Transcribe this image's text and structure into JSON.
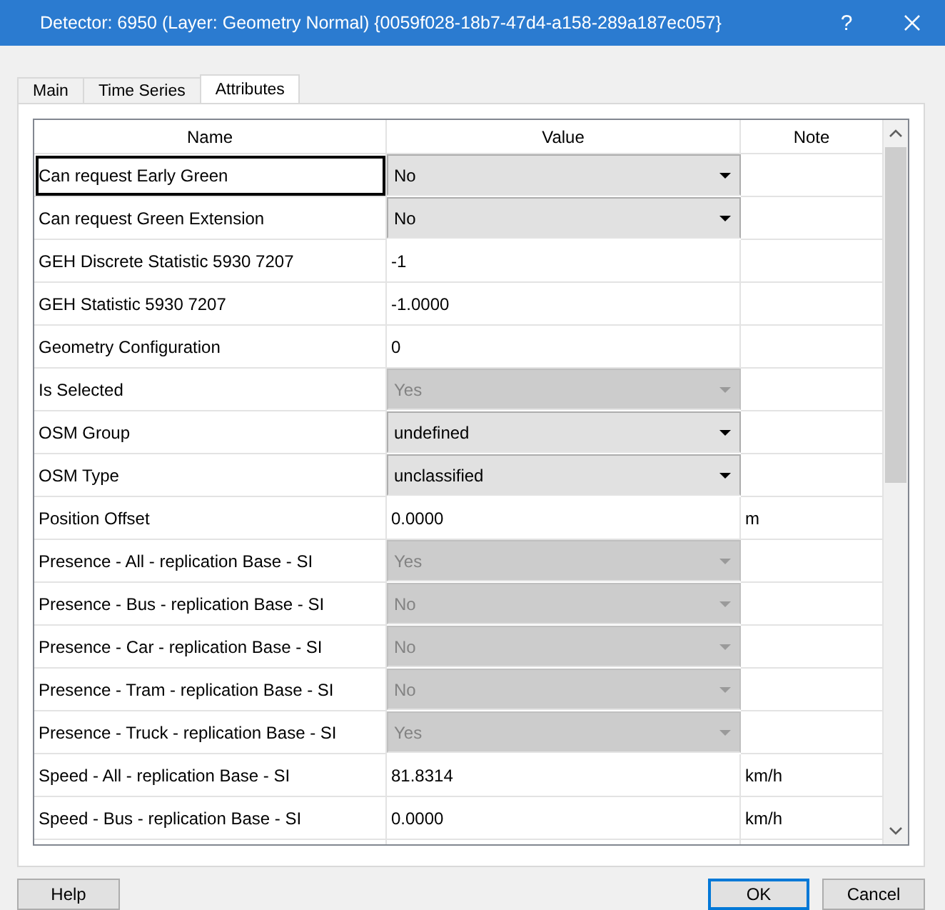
{
  "window": {
    "title": "Detector: 6950 (Layer: Geometry Normal) {0059f028-18b7-47d4-a158-289a187ec057}",
    "help_glyph": "?"
  },
  "tabs": [
    {
      "label": "Main",
      "selected": false
    },
    {
      "label": "Time Series",
      "selected": false
    },
    {
      "label": "Attributes",
      "selected": true
    }
  ],
  "table": {
    "columns": [
      "Name",
      "Value",
      "Note"
    ],
    "rows": [
      {
        "name": "Can request Early Green",
        "kind": "dropdown",
        "value": "No",
        "disabled": false,
        "focused": true
      },
      {
        "name": "Can request Green Extension",
        "kind": "dropdown",
        "value": "No",
        "disabled": false,
        "focused": false
      },
      {
        "name": "GEH Discrete Statistic 5930 7207",
        "kind": "text",
        "value": "-1",
        "focused": false
      },
      {
        "name": "GEH Statistic 5930 7207",
        "kind": "text",
        "value": "-1.0000",
        "focused": false
      },
      {
        "name": "Geometry Configuration",
        "kind": "text",
        "value": "0",
        "focused": false
      },
      {
        "name": "Is Selected",
        "kind": "dropdown",
        "value": "Yes",
        "disabled": true,
        "focused": false
      },
      {
        "name": "OSM Group",
        "kind": "dropdown",
        "value": "undefined",
        "disabled": false,
        "focused": false
      },
      {
        "name": "OSM Type",
        "kind": "dropdown",
        "value": "unclassified",
        "disabled": false,
        "focused": false
      },
      {
        "name": "Position Offset",
        "kind": "text",
        "value": "0.0000",
        "note": "m",
        "focused": false
      },
      {
        "name": "Presence - All - replication Base - SI",
        "kind": "dropdown",
        "value": "Yes",
        "disabled": true,
        "focused": false
      },
      {
        "name": "Presence - Bus - replication Base - SI",
        "kind": "dropdown",
        "value": "No",
        "disabled": true,
        "focused": false
      },
      {
        "name": "Presence - Car - replication Base - SI",
        "kind": "dropdown",
        "value": "No",
        "disabled": true,
        "focused": false
      },
      {
        "name": "Presence - Tram - replication Base - SI",
        "kind": "dropdown",
        "value": "No",
        "disabled": true,
        "focused": false
      },
      {
        "name": "Presence - Truck - replication Base - SI",
        "kind": "dropdown",
        "value": "Yes",
        "disabled": true,
        "focused": false
      },
      {
        "name": "Speed - All - replication Base - SI",
        "kind": "text",
        "value": "81.8314",
        "note": "km/h",
        "focused": false
      },
      {
        "name": "Speed - Bus - replication Base - SI",
        "kind": "text",
        "value": "0.0000",
        "note": "km/h",
        "focused": false
      }
    ]
  },
  "buttons": [
    {
      "label": "Help",
      "default": false
    },
    {
      "label": "OK",
      "default": true
    },
    {
      "label": "Cancel",
      "default": false
    }
  ]
}
